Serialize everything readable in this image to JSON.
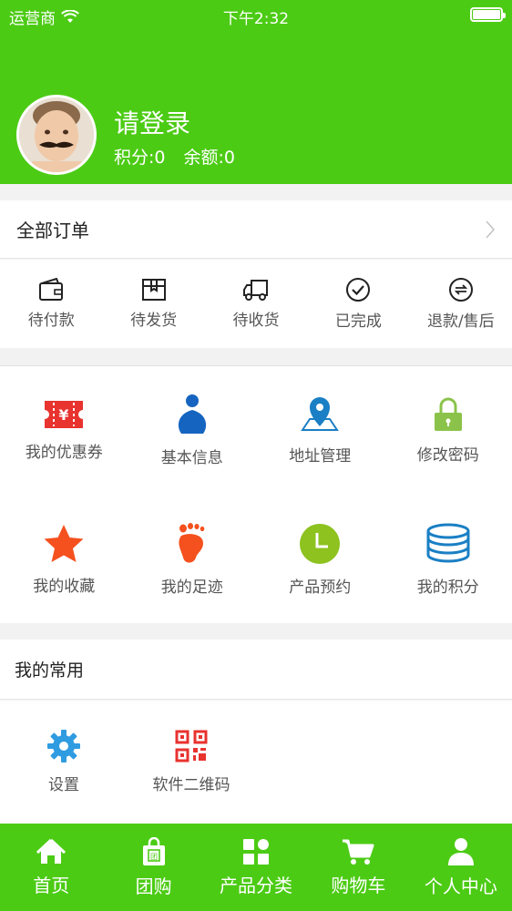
{
  "status_bar": {
    "carrier": "运营商",
    "time": "下午2:32"
  },
  "profile": {
    "login_text": "请登录",
    "points": "积分:0",
    "balance": "余额:0"
  },
  "orders": {
    "title": "全部订单",
    "items": [
      {
        "label": "待付款",
        "icon": "wallet-icon"
      },
      {
        "label": "待发货",
        "icon": "package-icon"
      },
      {
        "label": "待收货",
        "icon": "truck-icon"
      },
      {
        "label": "已完成",
        "icon": "check-circle-icon"
      },
      {
        "label": "退款/售后",
        "icon": "refund-icon"
      }
    ]
  },
  "services": [
    {
      "label": "我的优惠券",
      "icon": "coupon-icon",
      "color": "#e8332f"
    },
    {
      "label": "基本信息",
      "icon": "person-icon",
      "color": "#1565c0"
    },
    {
      "label": "地址管理",
      "icon": "location-pin-icon",
      "color": "#1a7fc4"
    },
    {
      "label": "修改密码",
      "icon": "lock-icon",
      "color": "#8bc34a"
    },
    {
      "label": "我的收藏",
      "icon": "star-icon",
      "color": "#f4511e"
    },
    {
      "label": "我的足迹",
      "icon": "footprint-icon",
      "color": "#f4511e"
    },
    {
      "label": "产品预约",
      "icon": "clock-icon",
      "color": "#8dc21f"
    },
    {
      "label": "我的积分",
      "icon": "coins-icon",
      "color": "#1a7fc4"
    }
  ],
  "common": {
    "title": "我的常用",
    "items": [
      {
        "label": "设置",
        "icon": "gear-icon",
        "color": "#2f9be0"
      },
      {
        "label": "软件二维码",
        "icon": "qr-code-icon",
        "color": "#e8332f"
      }
    ]
  },
  "tabbar": [
    {
      "label": "首页",
      "icon": "home-icon"
    },
    {
      "label": "团购",
      "icon": "group-buy-icon"
    },
    {
      "label": "产品分类",
      "icon": "category-icon"
    },
    {
      "label": "购物车",
      "icon": "cart-icon"
    },
    {
      "label": "个人中心",
      "icon": "user-icon"
    }
  ],
  "colors": {
    "brand_green": "#4ccb15",
    "background": "#f2f2f2"
  }
}
